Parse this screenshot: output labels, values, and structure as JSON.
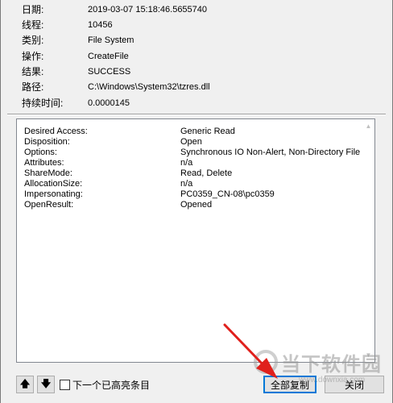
{
  "properties": [
    {
      "label": "日期:",
      "value": "2019-03-07 15:18:46.5655740"
    },
    {
      "label": "线程:",
      "value": "10456"
    },
    {
      "label": "类别:",
      "value": "File System"
    },
    {
      "label": "操作:",
      "value": "CreateFile"
    },
    {
      "label": "结果:",
      "value": "SUCCESS"
    },
    {
      "label": "路径:",
      "value": "C:\\Windows\\System32\\tzres.dll"
    },
    {
      "label": "持续时间:",
      "value": "0.0000145"
    }
  ],
  "details": [
    {
      "key": "Desired Access:",
      "value": "Generic Read"
    },
    {
      "key": "Disposition:",
      "value": "Open"
    },
    {
      "key": "Options:",
      "value": "Synchronous IO Non-Alert, Non-Directory File"
    },
    {
      "key": "Attributes:",
      "value": "n/a"
    },
    {
      "key": "ShareMode:",
      "value": "Read, Delete"
    },
    {
      "key": "AllocationSize:",
      "value": "n/a"
    },
    {
      "key": "Impersonating:",
      "value": "PC0359_CN-08\\pc0359"
    },
    {
      "key": "OpenResult:",
      "value": "Opened"
    }
  ],
  "footer": {
    "up_label": "🡅",
    "down_label": "🡇",
    "checkbox_label": "下一个已高亮条目",
    "copy_all_label": "全部复制",
    "close_label": "关闭"
  },
  "watermark": {
    "brand": "当下软件园",
    "url": "www.downxia.com"
  },
  "colors": {
    "annotation_arrow": "#e0201c",
    "focus_border": "#0078d7"
  }
}
